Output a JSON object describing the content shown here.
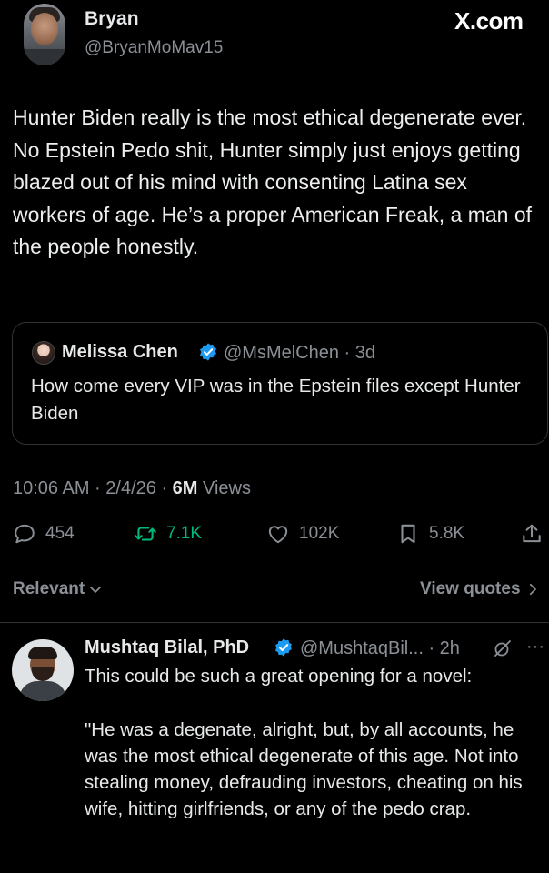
{
  "header": {
    "name": "Bryan",
    "handle": "@BryanMoMav15",
    "brand": "X.com"
  },
  "tweet": {
    "text": "Hunter Biden really is the most ethical degenerate ever. No Epstein Pedo shit, Hunter simply just enjoys getting blazed out of his mind with consenting Latina sex workers of age. He’s a proper American Freak, a man of the people honestly."
  },
  "quote": {
    "name": "Melissa Chen",
    "handle_time": "@MsMelChen · 3d",
    "text": "How come every VIP was in the Epstein files except Hunter Biden"
  },
  "meta": {
    "time_date": "10:06 AM · 2/4/26 · ",
    "views_count": "6M",
    "views_label": " Views"
  },
  "actions": {
    "replies": "454",
    "reposts": "7.1K",
    "likes": "102K",
    "bookmarks": "5.8K"
  },
  "sort": {
    "relevant": "Relevant",
    "view_quotes": "View quotes"
  },
  "reply": {
    "name": "Mushtaq Bilal, PhD",
    "handle_time": "@MushtaqBil... · 2h",
    "more": "···",
    "text": "This could be such a great opening for a novel:\n\n\"He was a degenate, alright, but, by all accounts, he was the most ethical degenerate of this age. Not into stealing money, defrauding investors, cheating on his wife, hitting girlfriends, or any of the pedo crap."
  },
  "colors": {
    "background": "#000000",
    "text": "#e7e9ea",
    "muted": "#8b9096",
    "repost_green": "#00ba7c",
    "verified_blue": "#1d9bf0",
    "border": "#2f3336"
  },
  "icons": [
    "reply-icon",
    "repost-icon",
    "like-icon",
    "bookmark-icon",
    "share-icon",
    "verified-icon",
    "chevron-down-icon",
    "chevron-right-icon",
    "grok-icon",
    "more-icon"
  ]
}
